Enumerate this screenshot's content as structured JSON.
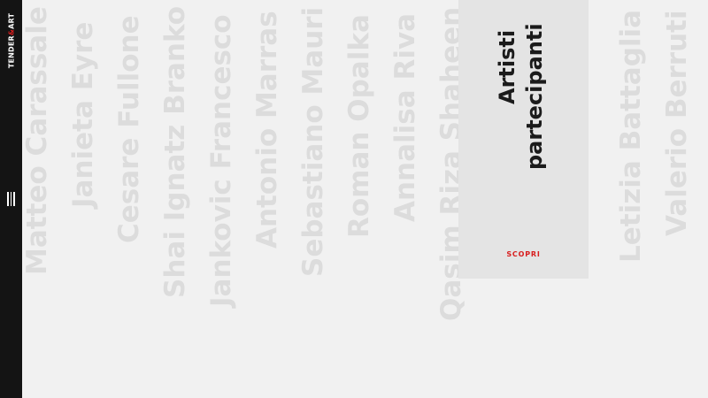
{
  "sidebar": {
    "logo_left": "TENDER",
    "logo_amp": "&",
    "logo_right": "ART",
    "menu_icon": "hamburger-menu-icon"
  },
  "artists": [
    "Matteo Carassale",
    "Janieta Eyre",
    "Cesare Fullone",
    "Shai Ignatz Branko",
    "Jankovic Francesco",
    "Antonio Marras",
    "Sebastiano Mauri",
    "Roman Opalka",
    "Annalisa Riva",
    "Qasim Riza Shaheen",
    "Letizia Battaglia",
    "Valerio Berruti"
  ],
  "feature": {
    "title_line1": "Artisti",
    "title_line2": "partecipanti",
    "link_label": "SCOPRI"
  },
  "colors": {
    "sidebar_bg": "#141414",
    "page_bg": "#f1f1f1",
    "panel_bg": "#e4e4e4",
    "artist_text": "#dcdcdc",
    "accent": "#d81e1e"
  }
}
